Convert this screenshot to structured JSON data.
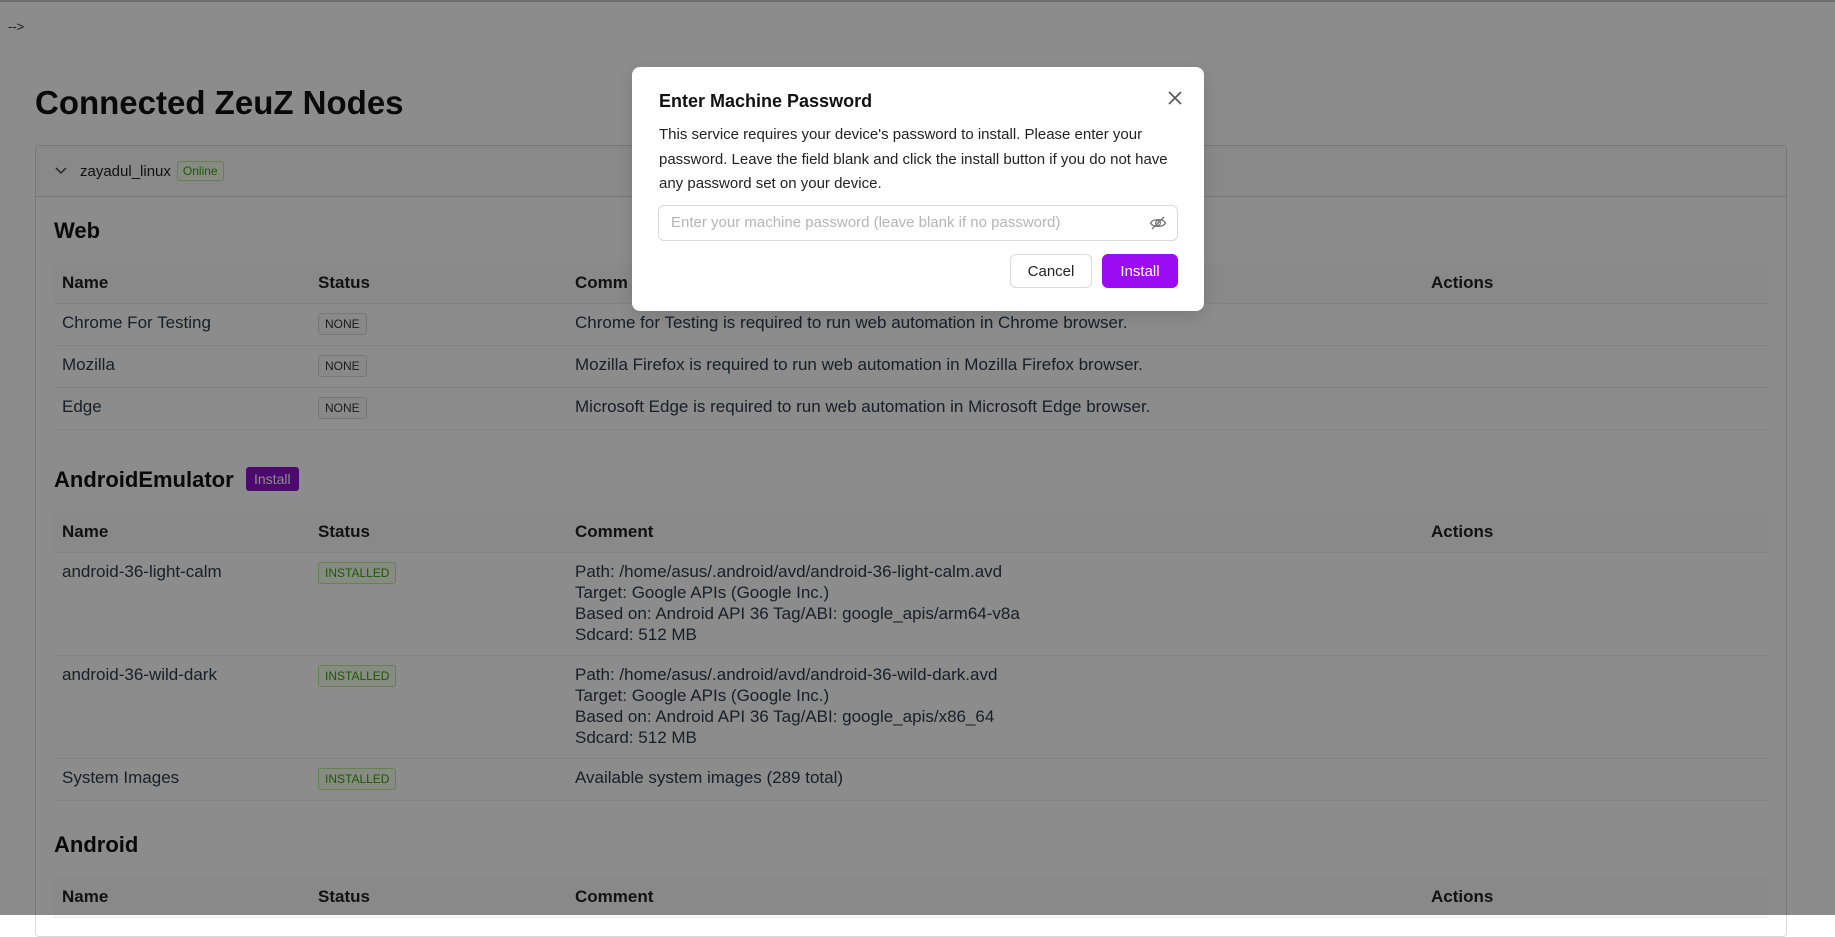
{
  "artifact": "-->",
  "page_title": "Connected ZeuZ Nodes",
  "node": {
    "name": "zayadul_linux",
    "status": "Online"
  },
  "columns": {
    "name": "Name",
    "status": "Status",
    "comment": "Comment",
    "comment_partial": "Comm",
    "actions": "Actions"
  },
  "web": {
    "title": "Web",
    "rows": [
      {
        "name": "Chrome For Testing",
        "status": "NONE",
        "comment": "Chrome for Testing is required to run web automation in Chrome browser."
      },
      {
        "name": "Mozilla",
        "status": "NONE",
        "comment": "Mozilla Firefox is required to run web automation in Mozilla Firefox browser."
      },
      {
        "name": "Edge",
        "status": "NONE",
        "comment": "Microsoft Edge is required to run web automation in Microsoft Edge browser."
      }
    ]
  },
  "emulator": {
    "title": "AndroidEmulator",
    "install_label": "Install",
    "rows": [
      {
        "name": "android-36-light-calm",
        "status": "INSTALLED",
        "comment_lines": [
          "Path: /home/asus/.android/avd/android-36-light-calm.avd",
          "Target: Google APIs (Google Inc.)",
          "Based on: Android API 36 Tag/ABI: google_apis/arm64-v8a",
          "Sdcard: 512 MB"
        ]
      },
      {
        "name": "android-36-wild-dark",
        "status": "INSTALLED",
        "comment_lines": [
          "Path: /home/asus/.android/avd/android-36-wild-dark.avd",
          "Target: Google APIs (Google Inc.)",
          "Based on: Android API 36 Tag/ABI: google_apis/x86_64",
          "Sdcard: 512 MB"
        ]
      },
      {
        "name": "System Images",
        "status": "INSTALLED",
        "comment_lines": [
          "Available system images (289 total)"
        ]
      }
    ]
  },
  "android": {
    "title": "Android"
  },
  "modal": {
    "title": "Enter Machine Password",
    "description": "This service requires your device's password to install. Please enter your password. Leave the field blank and click the install button if you do not have any password set on your device.",
    "input_placeholder": "Enter your machine password (leave blank if no password)",
    "input_value": "",
    "cancel_label": "Cancel",
    "install_label": "Install"
  },
  "colors": {
    "accent": "#9c0cf2",
    "tag_install": "#8b12c9",
    "success": "#389e0d"
  },
  "icons": {
    "close": "close-icon",
    "visibility": "eye-slash-icon",
    "collapse": "chevron-down-icon"
  }
}
